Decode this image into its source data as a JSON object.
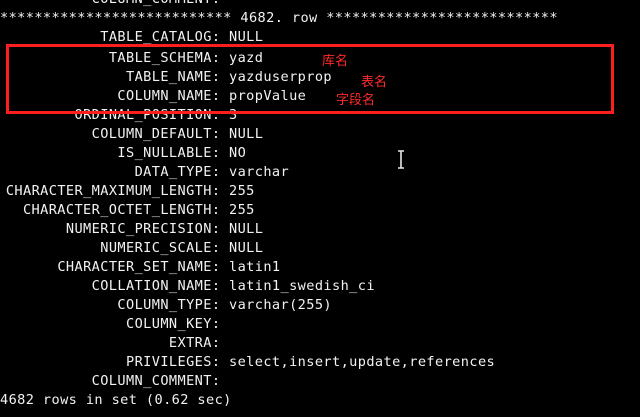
{
  "terminal": {
    "top_cut_line": "COLUMN_COMMENT:",
    "separator": "*************************** 4682. row ***************************",
    "rows": [
      {
        "label": "TABLE_CATALOG:",
        "value": "NULL"
      },
      {
        "label": "TABLE_SCHEMA:",
        "value": "yazd"
      },
      {
        "label": "TABLE_NAME:",
        "value": "yazduserprop"
      },
      {
        "label": "COLUMN_NAME:",
        "value": "propValue"
      },
      {
        "label": "ORDINAL_POSITION:",
        "value": "3"
      },
      {
        "label": "COLUMN_DEFAULT:",
        "value": "NULL"
      },
      {
        "label": "IS_NULLABLE:",
        "value": "NO"
      },
      {
        "label": "DATA_TYPE:",
        "value": "varchar"
      },
      {
        "label": "CHARACTER_MAXIMUM_LENGTH:",
        "value": "255"
      },
      {
        "label": "CHARACTER_OCTET_LENGTH:",
        "value": "255"
      },
      {
        "label": "NUMERIC_PRECISION:",
        "value": "NULL"
      },
      {
        "label": "NUMERIC_SCALE:",
        "value": "NULL"
      },
      {
        "label": "CHARACTER_SET_NAME:",
        "value": "latin1"
      },
      {
        "label": "COLLATION_NAME:",
        "value": "latin1_swedish_ci"
      },
      {
        "label": "COLUMN_TYPE:",
        "value": "varchar(255)"
      },
      {
        "label": "COLUMN_KEY:",
        "value": ""
      },
      {
        "label": "EXTRA:",
        "value": ""
      },
      {
        "label": "PRIVILEGES:",
        "value": "select,insert,update,references"
      },
      {
        "label": "COLUMN_COMMENT:",
        "value": ""
      }
    ],
    "summary": "4682 rows in set (0.62 sec)"
  },
  "annotations": {
    "schema_note": "库名",
    "table_note": "表名",
    "column_note": "字段名",
    "color": "#ff2a2a"
  },
  "cursor_icon": "text-ibeam-icon"
}
